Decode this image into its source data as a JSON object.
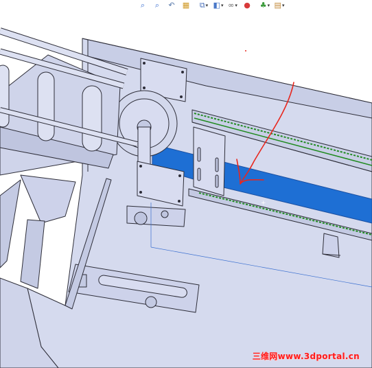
{
  "toolbar": {
    "items": [
      {
        "name": "zoom-to-fit-icon",
        "glyph": "⌕",
        "dropdown": false,
        "color": "#3a6fd0"
      },
      {
        "name": "zoom-to-area-icon",
        "glyph": "⌕",
        "dropdown": false,
        "color": "#3a6fd0"
      },
      {
        "name": "previous-view-icon",
        "glyph": "↶",
        "dropdown": false,
        "color": "#5577aa"
      },
      {
        "name": "section-view-icon",
        "glyph": "▦",
        "dropdown": false,
        "color": "#d09a28"
      },
      {
        "name": "view-orientation-icon",
        "glyph": "⧉",
        "dropdown": true,
        "color": "#4a6fb8"
      },
      {
        "name": "display-style-icon",
        "glyph": "◧",
        "dropdown": true,
        "color": "#4a78c8"
      },
      {
        "name": "hide-show-items-icon",
        "glyph": "∞",
        "dropdown": true,
        "color": "#666666"
      },
      {
        "name": "edit-appearance-icon",
        "glyph": "●",
        "dropdown": false,
        "color": "#d83a3a"
      },
      {
        "name": "apply-scene-icon",
        "glyph": "♣",
        "dropdown": true,
        "color": "#3a9a3a"
      },
      {
        "name": "view-settings-icon",
        "glyph": "▤",
        "dropdown": true,
        "color": "#c28a3a"
      }
    ]
  },
  "watermark": "三维网www.3dportal.cn",
  "colors": {
    "model_fill": "#d3d8ec",
    "model_fill_dark": "#b8bfd9",
    "edge": "#2d2d38",
    "selected_face": "#1e6fd4",
    "belt_green": "#1f8a1f",
    "annotation_red": "#e8271e",
    "watermark": "#ff1c1c"
  }
}
